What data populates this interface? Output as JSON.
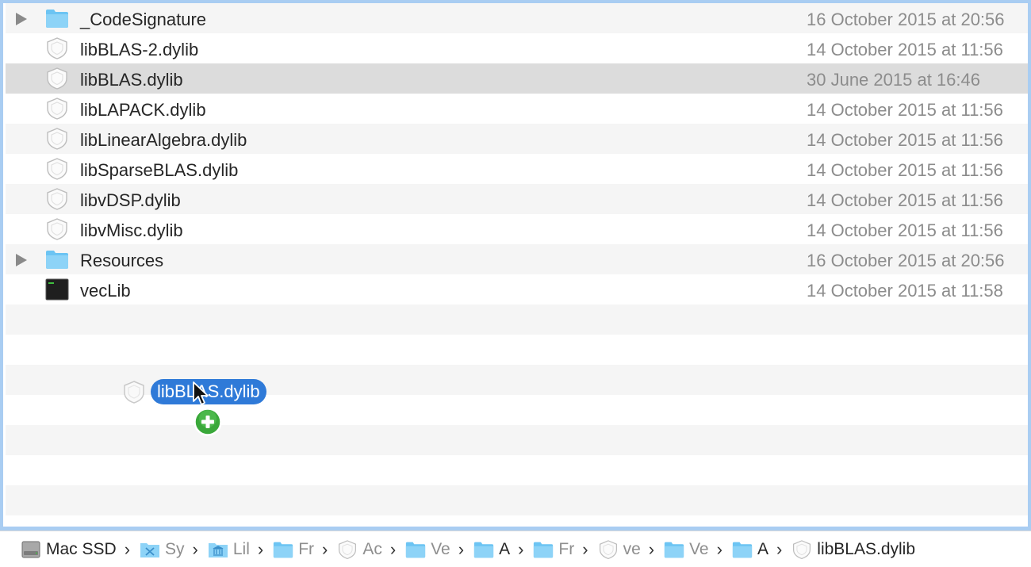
{
  "files": [
    {
      "name": "_CodeSignature",
      "date": "16 October 2015 at 20:56",
      "icon": "folder-icon",
      "expandable": true,
      "selected": false
    },
    {
      "name": "libBLAS-2.dylib",
      "date": "14 October 2015 at 11:56",
      "icon": "library-icon",
      "expandable": false,
      "selected": false
    },
    {
      "name": "libBLAS.dylib",
      "date": "30 June 2015 at 16:46",
      "icon": "library-icon",
      "expandable": false,
      "selected": true
    },
    {
      "name": "libLAPACK.dylib",
      "date": "14 October 2015 at 11:56",
      "icon": "library-icon",
      "expandable": false,
      "selected": false
    },
    {
      "name": "libLinearAlgebra.dylib",
      "date": "14 October 2015 at 11:56",
      "icon": "library-icon",
      "expandable": false,
      "selected": false
    },
    {
      "name": "libSparseBLAS.dylib",
      "date": "14 October 2015 at 11:56",
      "icon": "library-icon",
      "expandable": false,
      "selected": false
    },
    {
      "name": "libvDSP.dylib",
      "date": "14 October 2015 at 11:56",
      "icon": "library-icon",
      "expandable": false,
      "selected": false
    },
    {
      "name": "libvMisc.dylib",
      "date": "14 October 2015 at 11:56",
      "icon": "library-icon",
      "expandable": false,
      "selected": false
    },
    {
      "name": "Resources",
      "date": "16 October 2015 at 20:56",
      "icon": "folder-icon",
      "expandable": true,
      "selected": false
    },
    {
      "name": "vecLib",
      "date": "14 October 2015 at 11:58",
      "icon": "terminal-exec-icon",
      "expandable": false,
      "selected": false
    }
  ],
  "drag": {
    "label": "libBLAS.dylib",
    "icon": "library-icon",
    "badge_icon": "copy-plus-badge-icon"
  },
  "path_bar": [
    {
      "label": "Mac SSD",
      "icon": "hard-drive-icon",
      "truncated": false
    },
    {
      "label": "Sy",
      "icon": "system-folder-icon",
      "truncated": true
    },
    {
      "label": "Lil",
      "icon": "library-folder-icon",
      "truncated": true
    },
    {
      "label": "Fr",
      "icon": "folder-icon",
      "truncated": true
    },
    {
      "label": "Ac",
      "icon": "library-icon",
      "truncated": true
    },
    {
      "label": "Ve",
      "icon": "folder-icon",
      "truncated": true
    },
    {
      "label": "A",
      "icon": "folder-icon",
      "truncated": false
    },
    {
      "label": "Fr",
      "icon": "folder-icon",
      "truncated": true
    },
    {
      "label": "ve",
      "icon": "library-icon",
      "truncated": true
    },
    {
      "label": "Ve",
      "icon": "folder-icon",
      "truncated": true
    },
    {
      "label": "A",
      "icon": "folder-icon",
      "truncated": false
    },
    {
      "label": "libBLAS.dylib",
      "icon": "library-icon",
      "truncated": false
    }
  ],
  "path_separator": "›",
  "colors": {
    "selection_accent": "#2f7ad8",
    "selected_row": "#dcdcdc",
    "window_border": "#a9cdf2",
    "folder_blue": "#6cc4f3",
    "badge_green": "#3aa83a"
  }
}
